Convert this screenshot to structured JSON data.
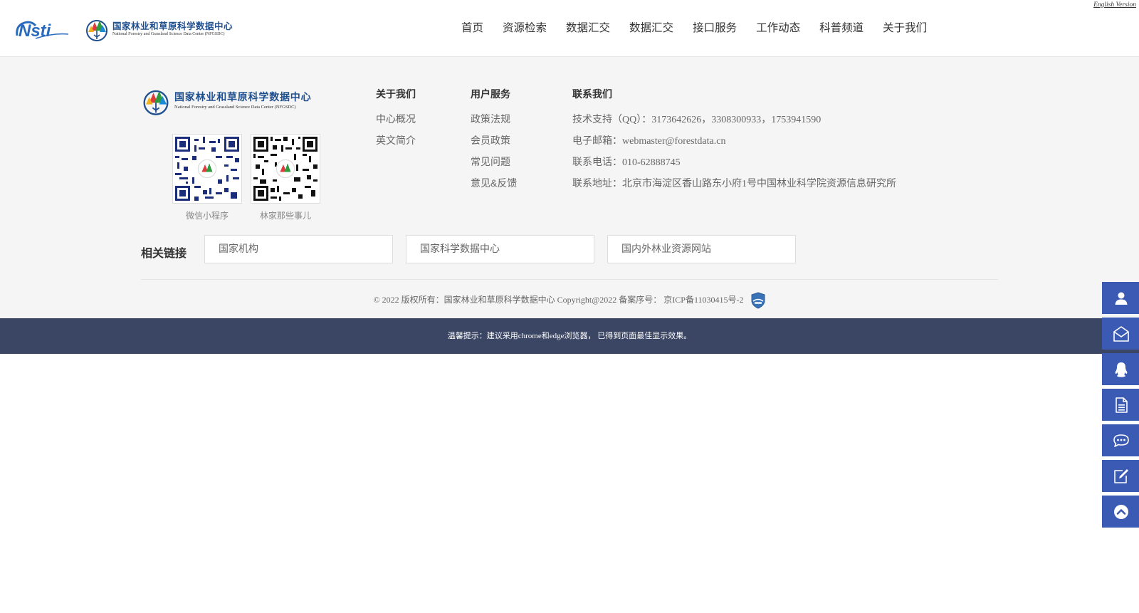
{
  "header": {
    "logo_nsti_text": "Nsti",
    "logo_cn": "国家林业和草原科学数据中心",
    "logo_en": "National Forestry and Grassland Science Data Center (NFGSDC)",
    "english_version": "English Version",
    "nav": [
      "首页",
      "资源检索",
      "数据汇交",
      "数据汇交",
      "接口服务",
      "工作动态",
      "科普频道",
      "关于我们"
    ]
  },
  "footer": {
    "logo_cn": "国家林业和草原科学数据中心",
    "logo_en": "National Forestry and Grassland Science Data Center (NFGSDC)",
    "qr_codes": [
      {
        "label": "微信小程序"
      },
      {
        "label": "林家那些事儿"
      }
    ],
    "about": {
      "title": "关于我们",
      "items": [
        "中心概况",
        "英文简介"
      ]
    },
    "services": {
      "title": "用户服务",
      "items": [
        "政策法规",
        "会员政策",
        "常见问题",
        "意见&反馈"
      ]
    },
    "contact": {
      "title": "联系我们",
      "items": [
        "技术支持（QQ）：3173642626，3308300933，1753941590",
        "电子邮箱：webmaster@forestdata.cn",
        "联系电话：010-62888745",
        "联系地址：北京市海淀区香山路东小府1号中国林业科学院资源信息研究所"
      ]
    },
    "links": {
      "label": "相关链接",
      "boxes": [
        "国家机构",
        "国家科学数据中心",
        "国内外林业资源网站"
      ]
    },
    "copyright": "© 2022 版权所有：国家林业和草原科学数据中心 Copyright@2022 备案序号： 京ICP备11030415号-2"
  },
  "tip_bar": {
    "text": "温馨提示：建议采用chrome和edge浏览器， 已得到页面最佳显示效果。"
  },
  "side_toolbar": {
    "buttons": [
      "user-icon",
      "mail-icon",
      "qq-icon",
      "document-icon",
      "chat-icon",
      "edit-icon",
      "back-to-top-icon"
    ]
  },
  "colors": {
    "brand_blue": "#1f4f8f",
    "side_button": "#3b5ab4",
    "tip_bar": "#3b4664",
    "footer_bg": "#f5f5f5"
  }
}
